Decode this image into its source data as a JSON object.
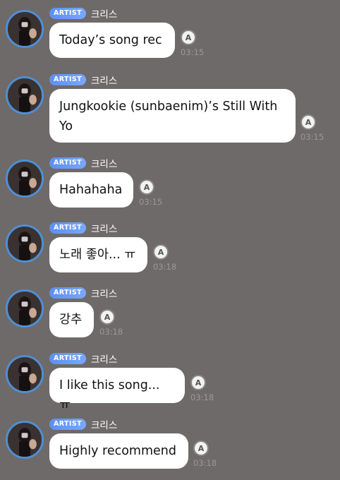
{
  "chat": {
    "messages": [
      {
        "badge": "ARTIST",
        "name": "크리스",
        "text": "Today’s song rec",
        "time": "03:15",
        "translate_icon": "translate-icon"
      },
      {
        "badge": "ARTIST",
        "name": "크리스",
        "text": "Jungkookie (sunbaenim)’s Still With Yo",
        "time": "03:15",
        "translate_icon": "translate-icon"
      },
      {
        "badge": "ARTIST",
        "name": "크리스",
        "text": "Hahahaha",
        "time": "03:15",
        "translate_icon": "translate-icon"
      },
      {
        "badge": "ARTIST",
        "name": "크리스",
        "text": "노래 좋아... ㅠ",
        "time": "03:18",
        "translate_icon": "translate-icon"
      },
      {
        "badge": "ARTIST",
        "name": "크리스",
        "text": "강추",
        "time": "03:18",
        "translate_icon": "translate-icon"
      },
      {
        "badge": "ARTIST",
        "name": "크리스",
        "text": "I like this song... ㅠ",
        "time": "03:18",
        "translate_icon": "translate-icon"
      },
      {
        "badge": "ARTIST",
        "name": "크리스",
        "text": "Highly recommend",
        "time": "03:18",
        "translate_icon": "translate-icon"
      }
    ]
  },
  "colors": {
    "background": "#6e6a69",
    "badge": "#5d8ff0",
    "bubble": "#ffffff",
    "avatar_ring": "#4f8fd6"
  }
}
